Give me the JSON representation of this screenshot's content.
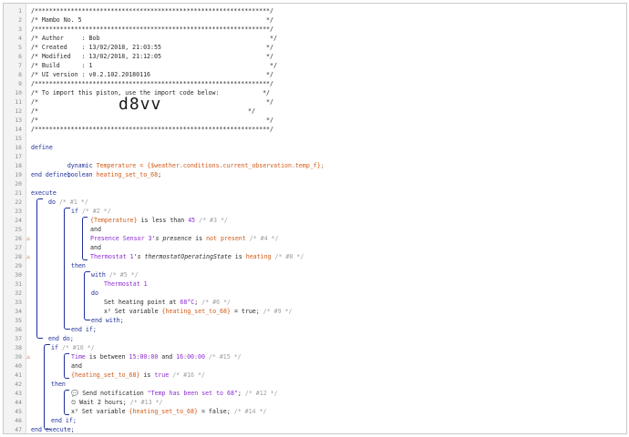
{
  "header": {
    "stars": "/*****************************************************************/",
    "title": "/* Mambo No. 5                                                   */",
    "stars2": "/*****************************************************************/",
    "author": "/* Author     : Bob                                               */",
    "created": "/* Created    : 13/02/2018, 21:03:55                             */",
    "modified": "/* Modified   : 13/02/2018, 21:12:05                             */",
    "build": "/* Build      : 1                                                 */",
    "ui_version": "/* UI version : v0.2.102.20180116                                */",
    "stars3": "/*****************************************************************/",
    "import_msg": "/* To import this piston, use the import code below:            */",
    "blank1": "/*                                                               */",
    "code_prefix": "/*",
    "code_suffix": "*/",
    "blank2": "/*                                                               */",
    "stars4": "/*****************************************************************/",
    "import_code": "d8vv"
  },
  "code": {
    "define": "define",
    "var1_kw": "dynamic",
    "var1_name": "Temperature",
    "var1_rest": " = {$weather.conditions.current_observation.temp_f};",
    "var2_kw": "boolean",
    "var2_name": "heating_set_to_68",
    "var2_rest": ";",
    "end_define": "end define;",
    "execute": "execute",
    "do": "do",
    "c1": "/* #1 */",
    "if": "if",
    "c2": "/* #2 */",
    "cond1_var": "{Temperature}",
    "cond1_op": " is less than ",
    "cond1_val": "45",
    "c3": "/* #3 */",
    "and": "and",
    "cond2_dev": "Presence Sensor 3",
    "cond2_attr": "'s presence",
    "cond2_op": " is ",
    "cond2_val": "not present",
    "c4": "/* #4 */",
    "cond3_dev": "Thermostat 1",
    "cond3_attr": "'s thermostatOperatingState",
    "cond3_op": " is ",
    "cond3_val": "heating",
    "c8": "/* #8 */",
    "then": "then",
    "with": "with",
    "c5": "/* #5 */",
    "thermostat": "Thermostat 1",
    "set_heat": "Set heating point at ",
    "set_heat_val": "68°C",
    "set_heat_end": ";",
    "c6": "/* #6 */",
    "setvar_icon": "x²",
    "setvar1_pre": " Set variable ",
    "setvar1_name": "{heating_set_to_68}",
    "setvar1_val": " = true;",
    "c9": "/* #9 */",
    "end_with": "end with;",
    "end_if": "end if;",
    "end_do": "end do;",
    "c10": "/* #10 */",
    "time_pre": "Time",
    "time_op": " is between ",
    "time_a": "15:00:00",
    "time_and": " and ",
    "time_b": "16:00:00",
    "c15": "/* #15 */",
    "cond5_var": "{heating_set_to_68}",
    "cond5_op": " is ",
    "cond5_val": "true",
    "c16": "/* #16 */",
    "notify_icon": "💬",
    "notify": " Send notification ",
    "notify_val": "\"Temp has been set to 68\"",
    "notify_end": ";",
    "c12": "/* #12 */",
    "wait_icon": "⏲",
    "wait": " Wait 2 hours;",
    "c13": "/* #13 */",
    "setvar2_pre": " Set variable ",
    "setvar2_name": "{heating_set_to_68}",
    "setvar2_val": " = false;",
    "c14": "/* #14 */",
    "end_execute": "end execute;"
  },
  "line_numbers": [
    "1",
    "2",
    "3",
    "4",
    "5",
    "6",
    "7",
    "8",
    "9",
    "10",
    "11",
    "12",
    "13",
    "14",
    "15",
    "16",
    "17",
    "18",
    "19",
    "20",
    "21",
    "22",
    "23",
    "24",
    "25",
    "26",
    "27",
    "28",
    "29",
    "30",
    "31",
    "32",
    "33",
    "34",
    "35",
    "36",
    "37",
    "38",
    "39",
    "40",
    "41",
    "42",
    "43",
    "44",
    "45",
    "46",
    "47"
  ],
  "colors": {
    "keyword": "#1f2f9a",
    "variable": "#d35a18",
    "device": "#8d2bd0",
    "comment": "#a0a0a0",
    "warning": "#d6462a"
  }
}
